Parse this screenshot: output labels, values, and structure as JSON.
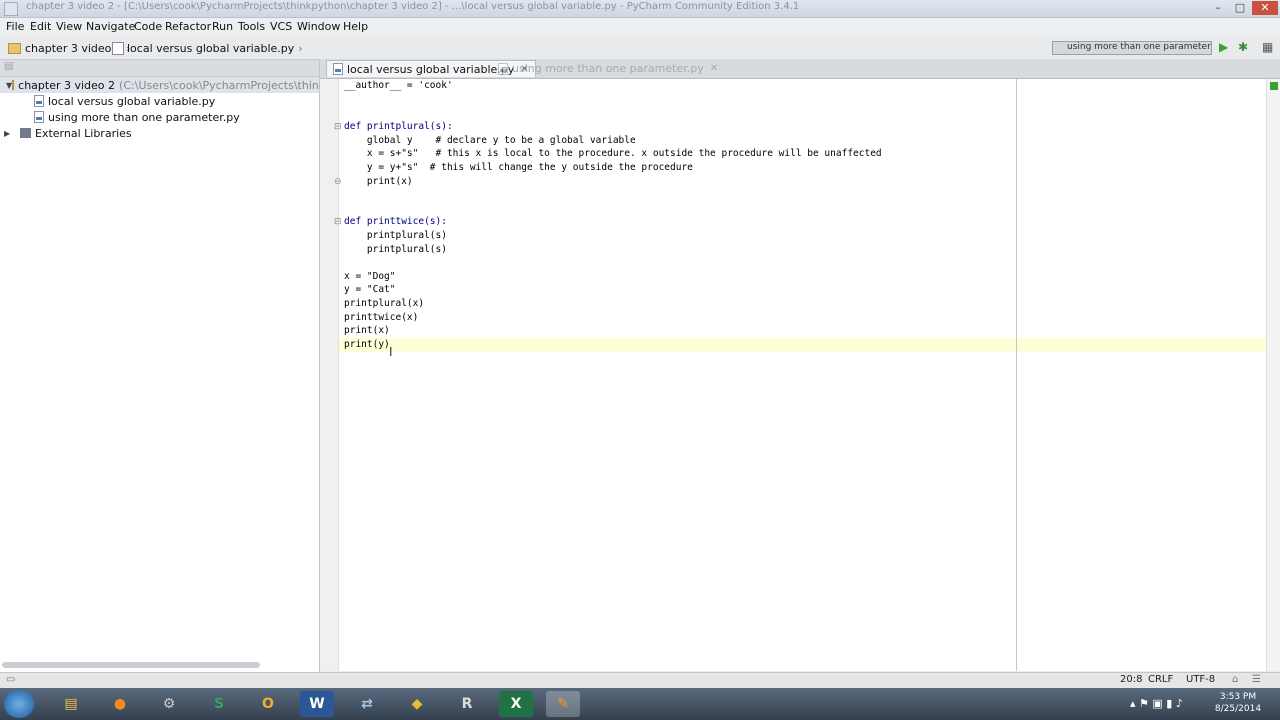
{
  "window": {
    "title": "chapter 3 video 2 - [C:\\Users\\cook\\PycharmProjects\\thinkpython\\chapter 3 video 2] - ...\\local versus global variable.py - PyCharm Community Edition 3.4.1",
    "controls": [
      "–",
      "□",
      "✕"
    ]
  },
  "menu": [
    "File",
    "Edit",
    "View",
    "Navigate",
    "Code",
    "Refactor",
    "Run",
    "Tools",
    "VCS",
    "Window",
    "Help"
  ],
  "breadcrumb": [
    "chapter 3 video 2",
    "local versus global variable.py"
  ],
  "run_config": "using more than one parameter",
  "project": {
    "root": "chapter 3 video 2",
    "root_path": "(C:\\Users\\cook\\PycharmProjects\\thinkpython\\c",
    "files": [
      "local versus global variable.py",
      "using more than one parameter.py"
    ],
    "libraries": "External Libraries"
  },
  "tabs": [
    {
      "label": "local versus global variable.py",
      "active": true
    },
    {
      "label": "using more than one parameter.py",
      "active": false
    }
  ],
  "code_lines": [
    "__author__ = 'cook'",
    "",
    "",
    "def printplural(s):",
    "    global y    # declare y to be a global variable",
    "    x = s+\"s\"   # this x is local to the procedure. x outside the procedure will be unaffected",
    "    y = y+\"s\"  # this will change the y outside the procedure",
    "    print(x)",
    "",
    "",
    "def printtwice(s):",
    "    printplural(s)",
    "    printplural(s)",
    "",
    "x = \"Dog\"",
    "y = \"Cat\"",
    "printplural(x)",
    "printtwice(x)",
    "print(x)",
    "print(y)"
  ],
  "status": {
    "position": "20:8",
    "line_sep": "CRLF",
    "encoding": "UTF-8"
  },
  "taskbar": {
    "time": "3:53 PM",
    "date": "8/25/2014",
    "apps": [
      "explorer",
      "firefox",
      "utility",
      "s-app",
      "outlook",
      "word",
      "network",
      "python",
      "r-app",
      "excel",
      "pycharm"
    ]
  }
}
